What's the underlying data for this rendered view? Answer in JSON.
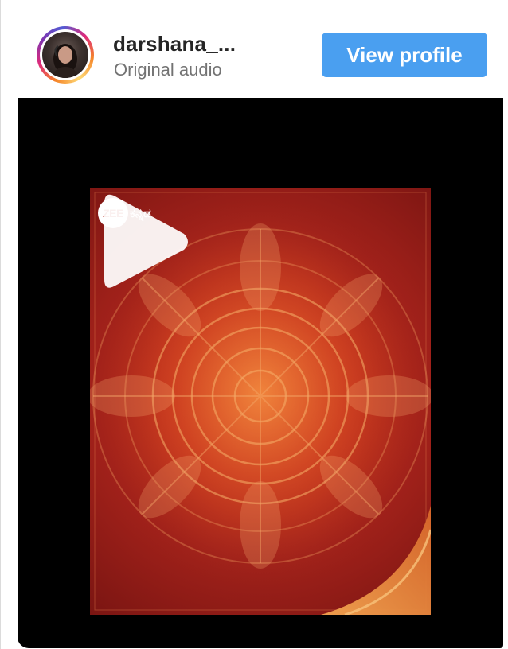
{
  "header": {
    "username": "darshana_...",
    "subtitle": "Original audio",
    "view_profile_label": "View profile"
  },
  "video": {
    "logo_mark": "ZEE",
    "logo_text": "ಕನ್ನಡ",
    "play_icon": "play-icon",
    "colors": {
      "background": "#000000",
      "poster_red": "#b22a1c",
      "button_blue": "#4a9ff0"
    }
  }
}
